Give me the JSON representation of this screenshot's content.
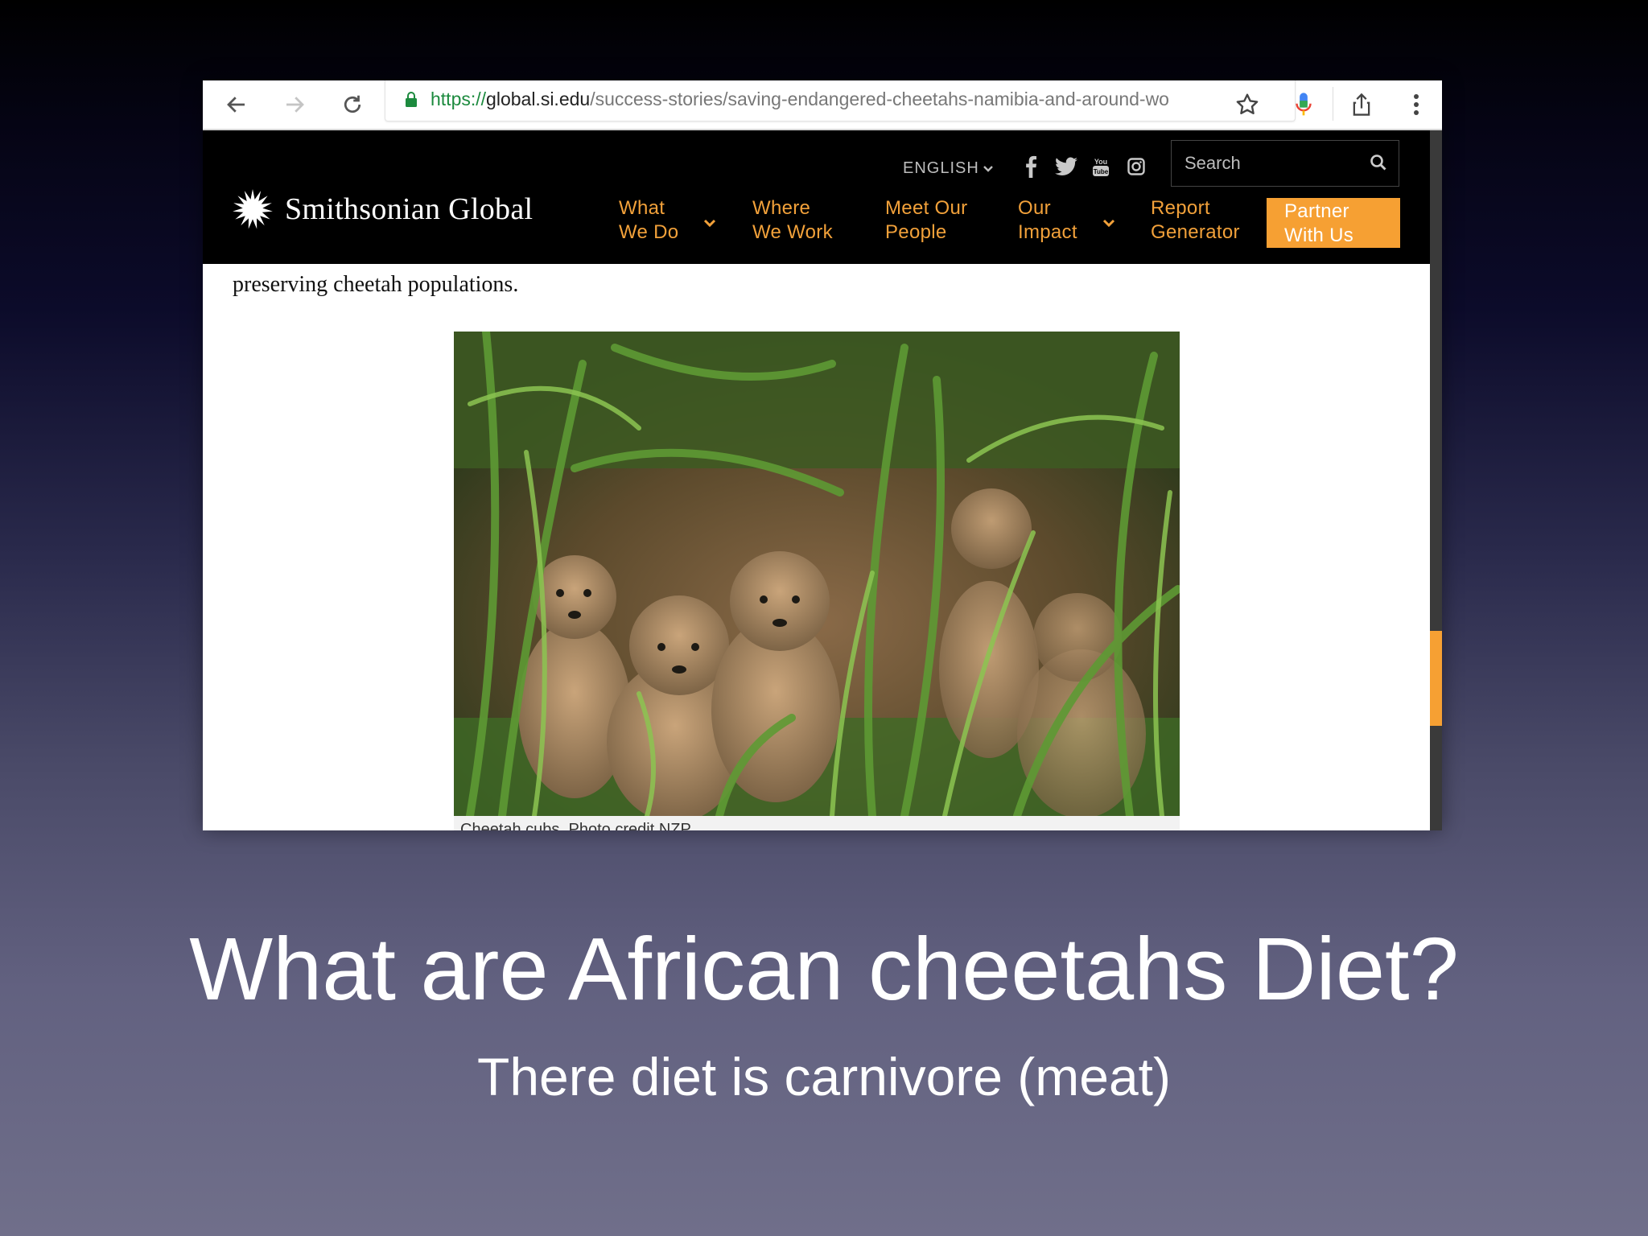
{
  "browser": {
    "url_scheme": "https://",
    "url_host": "global.si.edu",
    "url_path": "/success-stories/saving-endangered-cheetahs-namibia-and-around-wo"
  },
  "site": {
    "logo_text": "Smithsonian Global",
    "language": "ENGLISH",
    "search_placeholder": "Search",
    "nav": [
      {
        "line1": "What",
        "line2": "We Do"
      },
      {
        "line1": "Where",
        "line2": "We Work"
      },
      {
        "line1": "Meet Our",
        "line2": "People"
      },
      {
        "line1": "Our",
        "line2": "Impact"
      },
      {
        "line1": "Report",
        "line2": "Generator"
      }
    ],
    "partner": {
      "line1": "Partner",
      "line2": "With Us"
    },
    "accent_color": "#f6a033"
  },
  "content": {
    "paragraph": "preserving cheetah populations.",
    "caption": "Cheetah cubs. Photo credit NZP"
  },
  "slide": {
    "title": "What are African cheetahs Diet?",
    "subtitle": "There diet is carnivore (meat)"
  }
}
